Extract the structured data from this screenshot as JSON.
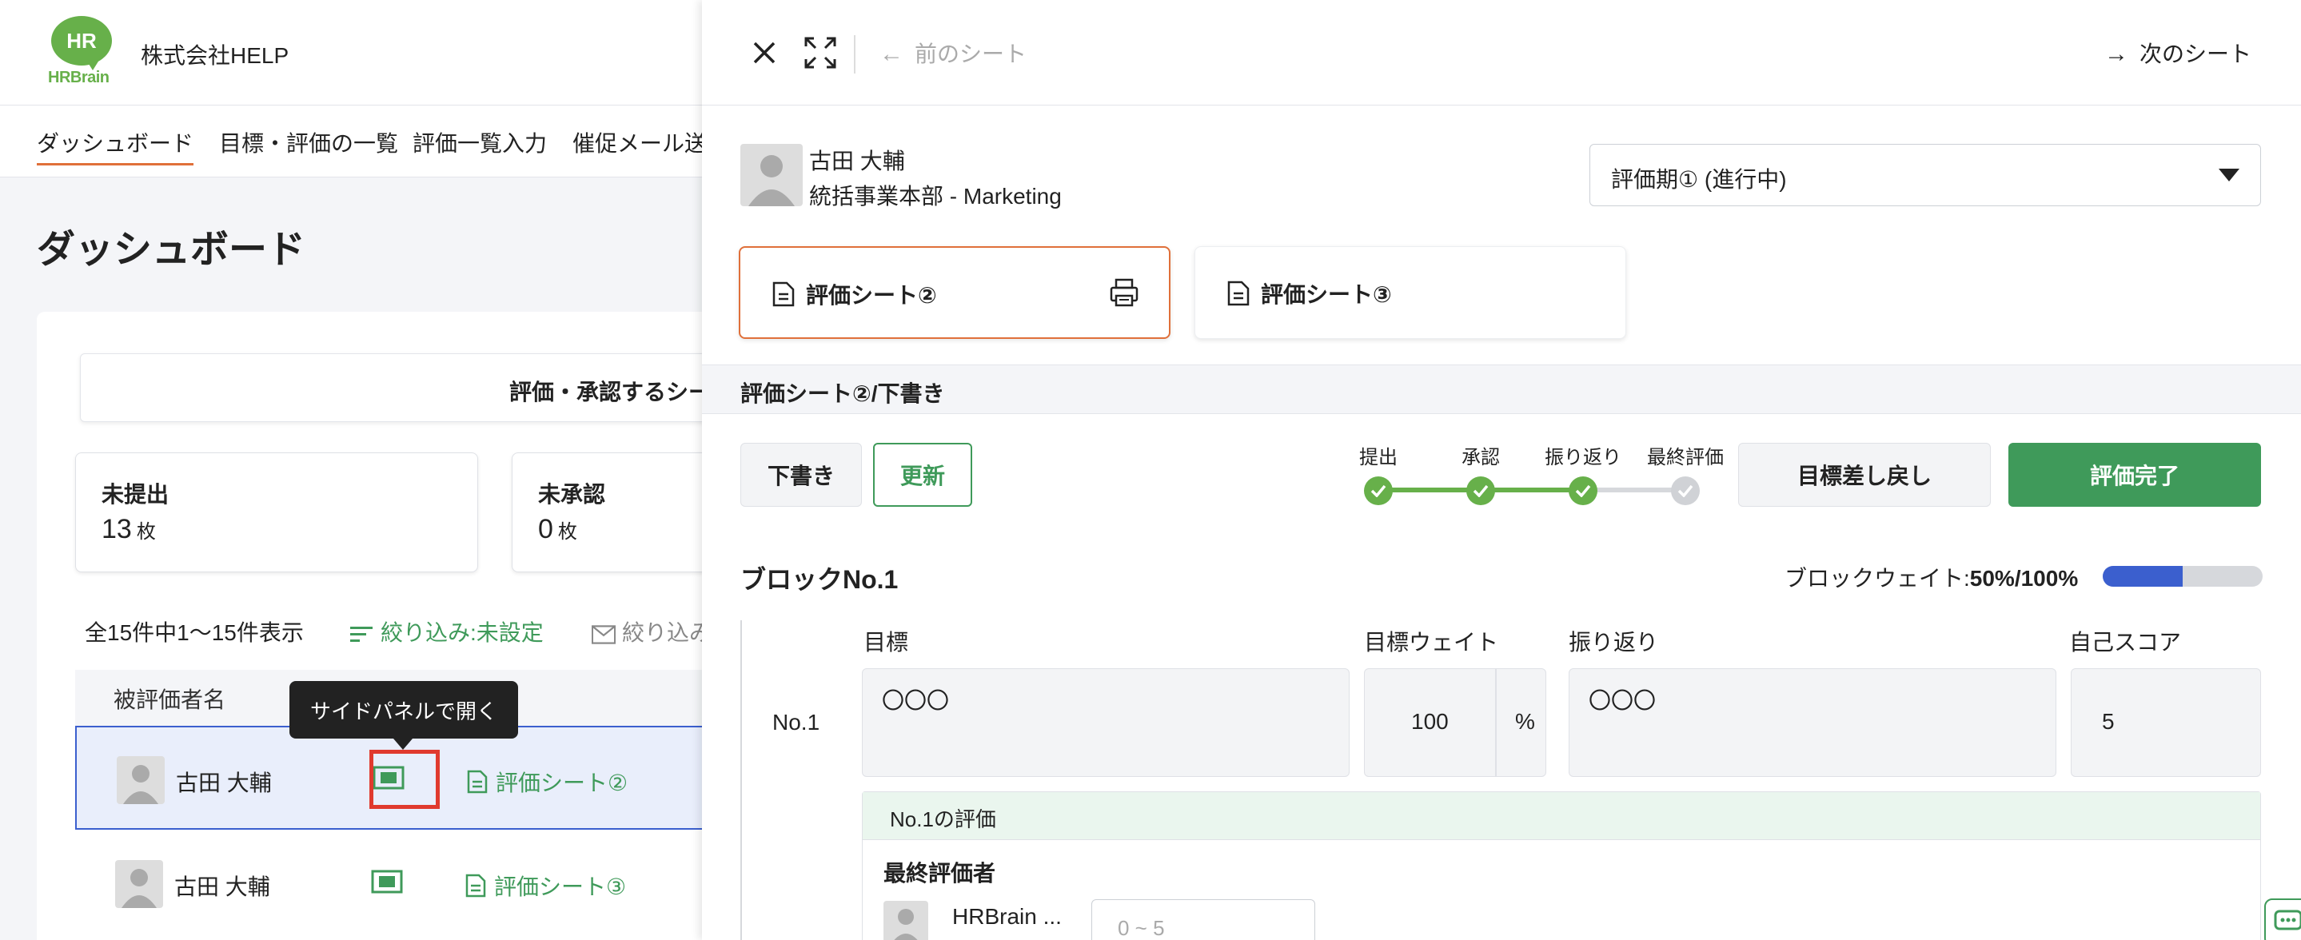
{
  "brand": {
    "logo_mark": "HR",
    "logo_text": "HRBrain",
    "company": "株式会社HELP"
  },
  "nav": [
    {
      "label": "ダッシュボード",
      "active": true
    },
    {
      "label": "目標・評価の一覧"
    },
    {
      "label": "評価一覧入力"
    },
    {
      "label": "催促メール送"
    }
  ],
  "page_title": "ダッシュボード",
  "tab_label": "評価・承認するシー",
  "stats": [
    {
      "label": "未提出",
      "value": "13",
      "unit": "枚"
    },
    {
      "label": "未承認",
      "value": "0",
      "unit": "枚"
    }
  ],
  "list": {
    "info": "全15件中1〜15件表示",
    "filter": "絞り込み:未設定",
    "filter2": "絞り込み",
    "column": "被評価者名",
    "rows": [
      {
        "name": "古田 大輔",
        "sheet": "評価シート②"
      },
      {
        "name": "古田 大輔",
        "sheet": "評価シート③"
      }
    ],
    "tooltip": "サイドパネルで開く"
  },
  "panel": {
    "prev": "前のシート",
    "next": "次のシート",
    "employee": {
      "name": "古田 大輔",
      "dept": "統括事業本部 - Marketing"
    },
    "period": "評価期① (進行中)",
    "sheets": [
      "評価シート②",
      "評価シート③"
    ],
    "status": "評価シート②/下書き",
    "buttons": {
      "draft": "下書き",
      "update": "更新",
      "return": "目標差し戻し",
      "complete": "評価完了"
    },
    "steps": [
      {
        "label": "提出",
        "done": true
      },
      {
        "label": "承認",
        "done": true
      },
      {
        "label": "振り返り",
        "done": true
      },
      {
        "label": "最終評価",
        "done": false
      }
    ],
    "block": {
      "title": "ブロックNo.1",
      "weight_label": "ブロックウェイト:",
      "weight_value": "50%/100%",
      "weight_fraction": 0.5,
      "columns": {
        "goal": "目標",
        "weight": "目標ウェイト",
        "review": "振り返り",
        "self_score": "自己スコア"
      },
      "row": {
        "no": "No.1",
        "goal": "〇〇〇",
        "weight": "100",
        "unit": "%",
        "review": "〇〇〇",
        "self_score": "5"
      },
      "eval": {
        "head": "No.1の評価",
        "label": "最終評価者",
        "evaluator": "HRBrain ...",
        "placeholder": "0 ~ 5"
      }
    }
  },
  "colors": {
    "accent_green": "#3f9a5a",
    "accent_orange": "#e0703a",
    "accent_blue": "#3b5fce",
    "highlight_red": "#e03a2e"
  }
}
